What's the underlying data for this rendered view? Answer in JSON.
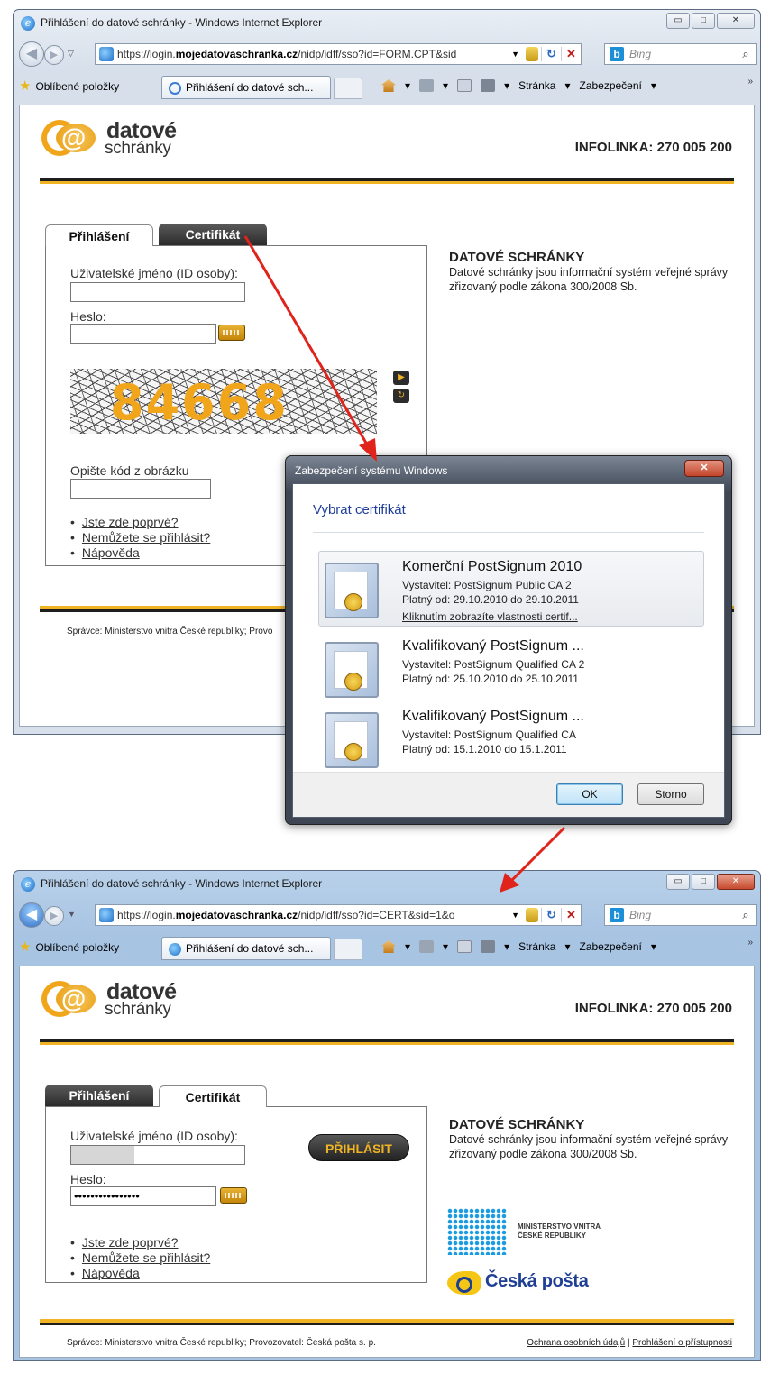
{
  "browser": {
    "title": "Přihlášení do datové schránky - Windows Internet Explorer",
    "window_buttons": [
      "▭",
      "□",
      "✕"
    ],
    "back_icon": "back-arrow-icon",
    "search_provider": "Bing",
    "favorites_label": "Oblíbené položky",
    "tab_label": "Přihlášení do datové sch...",
    "cmd_page": "Stránka",
    "cmd_security": "Zabezpečení",
    "refresh_glyph": "↻",
    "stop_glyph": "✕",
    "chevron": "»"
  },
  "window1": {
    "url_prefix": "https://login.",
    "url_domain": "mojedatovaschranka.cz",
    "url_path": "/nidp/idff/sso?id=FORM.CPT&sid"
  },
  "window2": {
    "url_prefix": "https://login.",
    "url_domain": "mojedatovaschranka.cz",
    "url_path": "/nidp/idff/sso?id=CERT&sid=1&o"
  },
  "page": {
    "logo_line1": "datové",
    "logo_line2": "schránky",
    "logo_at": "@",
    "infolinka": "INFOLINKA: 270 005 200",
    "tab_login": "Přihlášení",
    "tab_certificate": "Certifikát",
    "username_label": "Uživatelské jméno (ID osoby):",
    "password_label": "Heslo:",
    "password_value": "••••••••••••••••",
    "captcha_code": "84668",
    "captcha_label": "Opište kód z obrázku",
    "link_first_time": "Jste zde poprvé?",
    "link_cannot_login": "Nemůžete se přihlásit?",
    "link_help": "Nápověda",
    "info_title": "DATOVÉ SCHRÁNKY",
    "info_text": "Datové schránky jsou informační systém veřejné správy zřizovaný podle zákona 300/2008 Sb.",
    "submit_label": "PŘIHLÁSIT",
    "footer_text_short": "Správce: Ministerstvo vnitra České republiky; Provo",
    "footer_text": "Správce: Ministerstvo vnitra České republiky; Provozovatel: Česká pošta s. p.",
    "footer_link_privacy": "Ochrana osobních údajů",
    "footer_separator": "|",
    "footer_link_accessibility": "Prohlášení o přístupnosti",
    "mv_line1": "MINISTERSTVO VNITRA",
    "mv_line2": "ČESKÉ REPUBLIKY",
    "ceska_posta": "Česká pošta"
  },
  "dialog": {
    "window_title": "Zabezpečení systému Windows",
    "close_glyph": "✕",
    "heading": "Vybrat certifikát",
    "certificates": [
      {
        "name": "Komerční PostSignum 2010",
        "issuer": "Vystavitel: PostSignum Public CA 2",
        "validity": "Platný od: 29.10.2010 do 29.10.2011",
        "details_link": "Kliknutím zobrazíte vlastnosti certif..."
      },
      {
        "name": "Kvalifikovaný PostSignum ...",
        "issuer": "Vystavitel: PostSignum Qualified CA 2",
        "validity": "Platný od: 25.10.2010 do 25.10.2011"
      },
      {
        "name": "Kvalifikovaný PostSignum ...",
        "issuer": "Vystavitel: PostSignum Qualified CA",
        "validity": "Platný od: 15.1.2010 do 15.1.2011"
      }
    ],
    "ok_label": "OK",
    "cancel_label": "Storno"
  },
  "colors": {
    "accent_orange": "#f0b323",
    "arrow_red": "#e0241b",
    "dialog_heading": "#1e3e9b"
  }
}
